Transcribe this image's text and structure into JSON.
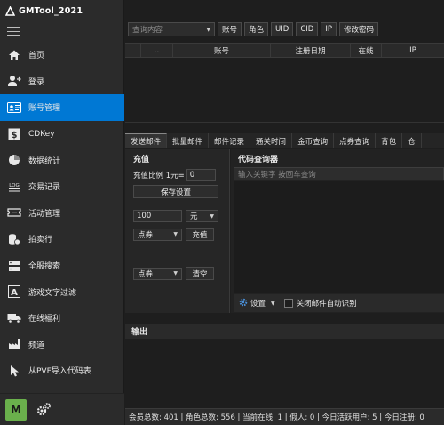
{
  "app": {
    "title": "GMTool_2021"
  },
  "sidebar": {
    "items": [
      {
        "label": "首页",
        "icon": "home-icon"
      },
      {
        "label": "登录",
        "icon": "user-login-icon"
      },
      {
        "label": "账号管理",
        "icon": "id-card-icon",
        "active": true
      },
      {
        "label": "CDKey",
        "icon": "dollar-icon"
      },
      {
        "label": "数据统计",
        "icon": "pie-chart-icon"
      },
      {
        "label": "交易记录",
        "icon": "log-icon"
      },
      {
        "label": "活动管理",
        "icon": "ticket-icon"
      },
      {
        "label": "拍卖行",
        "icon": "coins-icon"
      },
      {
        "label": "全服搜索",
        "icon": "server-search-icon"
      },
      {
        "label": "游戏文字过滤",
        "icon": "text-filter-icon"
      },
      {
        "label": "在线福利",
        "icon": "truck-icon"
      },
      {
        "label": "频道",
        "icon": "factory-icon"
      },
      {
        "label": "从PVF导入代码表",
        "icon": "cursor-icon"
      }
    ],
    "bottom_badge": "M"
  },
  "search": {
    "placeholder": "查询内容",
    "buttons": [
      "账号",
      "角色",
      "UID",
      "CID",
      "IP",
      "修改密码"
    ]
  },
  "table": {
    "columns": [
      "..",
      "账号",
      "注册日期",
      "在线",
      "IP"
    ]
  },
  "tabs": [
    "发送邮件",
    "批量邮件",
    "邮件记录",
    "通关时间",
    "金币查询",
    "点券查询",
    "背包",
    "仓"
  ],
  "recharge": {
    "title": "充值",
    "ratio_label": "充值比例 1元=",
    "ratio_value": "0",
    "save_label": "保存设置",
    "amount_value": "100",
    "unit": "元",
    "type_value": "点券",
    "recharge_label": "充值",
    "clear_type_value": "点券",
    "clear_label": "清空"
  },
  "code_query": {
    "title": "代码查询器",
    "placeholder": "输入关键字 按回车查询",
    "settings_label": "设置",
    "auto_mail_label": "关闭邮件自动识别"
  },
  "output": {
    "title": "输出"
  },
  "status": {
    "text": "会员总数: 401 | 角色总数: 556 | 当前在线: 1 | 假人: 0 | 今日活跃用户: 5 | 今日注册: 0"
  },
  "colors": {
    "accent": "#0078d4",
    "badge": "#6ab04c"
  }
}
